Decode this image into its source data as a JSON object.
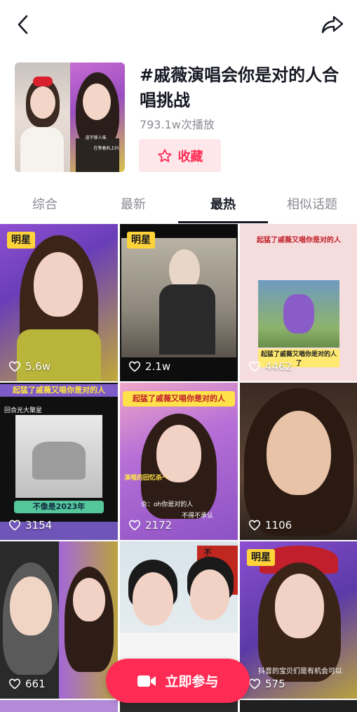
{
  "topbar": {
    "back_icon": "chevron-left-icon",
    "share_icon": "share-arrow-icon"
  },
  "topic": {
    "title": "#戚薇演唱会你是对的人合唱挑战",
    "play_count": "793.1w次播放",
    "favorite_label": "收藏",
    "favorite_icon": "star-outline-icon",
    "cover_caption_1": "道不够人味",
    "cover_caption_2": "在等着机上抖"
  },
  "tabs": [
    {
      "label": "综合",
      "active": false
    },
    {
      "label": "最新",
      "active": false
    },
    {
      "label": "最热",
      "active": true
    },
    {
      "label": "相似话题",
      "active": false
    }
  ],
  "videos": [
    {
      "badge": "明星",
      "likes": "5.6w"
    },
    {
      "badge": "明星",
      "likes": "2.1w"
    },
    {
      "badge": "",
      "likes": "4462",
      "top_text": "起猛了戚薇又唱你是对的人",
      "sub_text": "起猛了戚薇又唱你是对的人了"
    },
    {
      "badge": "",
      "likes": "3154",
      "top_text": "起猛了戚薇又唱你是对的人",
      "corner_text": "回合光大聚星",
      "bottom_text": "不像是2023年"
    },
    {
      "badge": "",
      "likes": "2172",
      "top_text": "起猛了戚薇又唱你是对的人",
      "overlay_1": "演唱的回忆杀～",
      "overlay_2": "合：oh你是对的人",
      "overlay_3": "不得不承认"
    },
    {
      "badge": "",
      "likes": "1106"
    },
    {
      "badge": "",
      "likes": "661"
    },
    {
      "badge": "",
      "likes": "",
      "poster_text": "不甘平凡"
    },
    {
      "badge": "明星",
      "likes": "575",
      "caption": "抖音的宝贝们是有机会可以"
    }
  ],
  "join_button": {
    "label": "立即参与",
    "icon": "video-camera-icon"
  },
  "colors": {
    "accent": "#fe2c55",
    "badge": "#ffd439",
    "favorite_bg": "#fde7ea",
    "muted_text": "#8a8b91"
  }
}
